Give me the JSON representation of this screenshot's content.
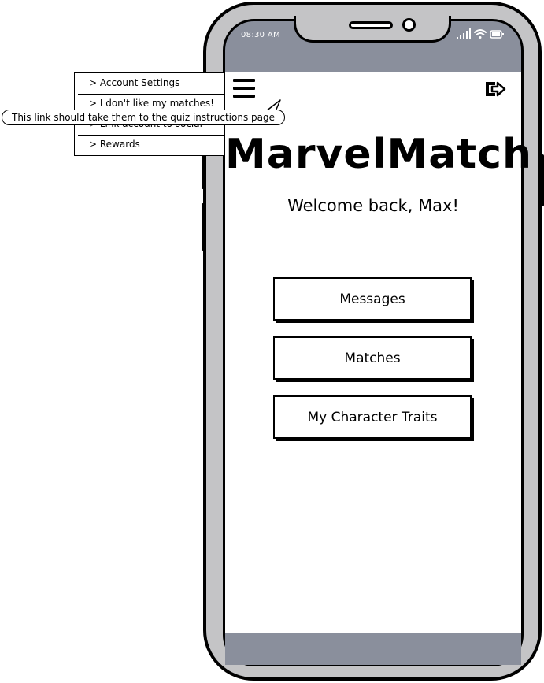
{
  "status_bar": {
    "time": "08:30 AM",
    "icons": [
      "signal-icon",
      "wifi-icon",
      "battery-icon"
    ]
  },
  "header": {
    "menu_icon": "hamburger-menu-icon",
    "logout_icon": "logout-icon"
  },
  "dropdown_menu": {
    "items": [
      {
        "label": "> Account Settings"
      },
      {
        "label": "> I don't like my matches!"
      },
      {
        "label": "> Link account to social"
      },
      {
        "label": "> Rewards"
      }
    ]
  },
  "callout": {
    "text": "This link should take them to the quiz instructions page"
  },
  "main": {
    "app_title": "MarvelMatch",
    "welcome": "Welcome back, Max!",
    "buttons": [
      {
        "label": "Messages"
      },
      {
        "label": "Matches"
      },
      {
        "label": "My Character Traits"
      }
    ]
  },
  "colors": {
    "phone_body": "#c4c4c6",
    "screen_chrome": "#8a8f9c",
    "content_bg": "#ffffff",
    "ink": "#000000"
  }
}
